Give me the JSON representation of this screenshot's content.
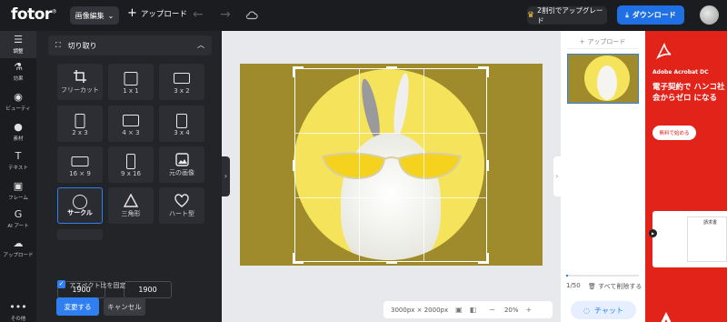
{
  "app": {
    "logo": "fotor",
    "logo_mark": "®"
  },
  "topbar": {
    "edit_menu": "画像編集",
    "upload": "アップロード",
    "upgrade": "2割引でアップグレード",
    "download": "ダウンロード"
  },
  "rail": {
    "items": [
      {
        "label": "調整",
        "icon": "sliders-icon",
        "active": true
      },
      {
        "label": "効果",
        "icon": "flask-icon"
      },
      {
        "label": "ビューティ",
        "icon": "eye-icon"
      },
      {
        "label": "素材",
        "icon": "sticker-icon"
      },
      {
        "label": "テキスト",
        "icon": "text-icon"
      },
      {
        "label": "フレーム",
        "icon": "frame-icon"
      },
      {
        "label": "AI アート",
        "icon": "ai-art-icon"
      },
      {
        "label": "アップロード",
        "icon": "cloud-upload-icon"
      },
      {
        "label": "その他",
        "icon": "more-icon"
      }
    ]
  },
  "panel": {
    "title": "切り取り",
    "presets": [
      {
        "label": "フリーカット"
      },
      {
        "label": "1 x 1"
      },
      {
        "label": "3 x 2"
      },
      {
        "label": "2 x 3"
      },
      {
        "label": "4 × 3"
      },
      {
        "label": "3 x 4"
      },
      {
        "label": "16 × 9"
      },
      {
        "label": "9 x 16"
      },
      {
        "label": "元の画像"
      },
      {
        "label": "サークル",
        "selected": true
      },
      {
        "label": "三角形"
      },
      {
        "label": "ハート型"
      }
    ],
    "width": "1900",
    "height": "1900",
    "times": "×",
    "keep_ratio": "アスペクト比を固定",
    "apply": "変更する",
    "cancel": "キャンセル"
  },
  "canvas": {
    "size_label": "3000px × 2000px",
    "zoom": "20%"
  },
  "pages": {
    "add_page": "アップロード",
    "count": "1/50",
    "delete_all": "すべて削除する",
    "chat": "チャット",
    "storage_used_fraction": 0.02
  },
  "ad": {
    "brand": "Adobe Acrobat DC",
    "copy": "電子契約で ハンコ社会からゼロ になる",
    "cta": "無料で始める",
    "doc_title": "請求書",
    "brand_color": "#e2231a"
  },
  "colors": {
    "accent": "#2f7ff0",
    "download": "#1f6fe5",
    "background_yellow": "#f5e45b"
  }
}
